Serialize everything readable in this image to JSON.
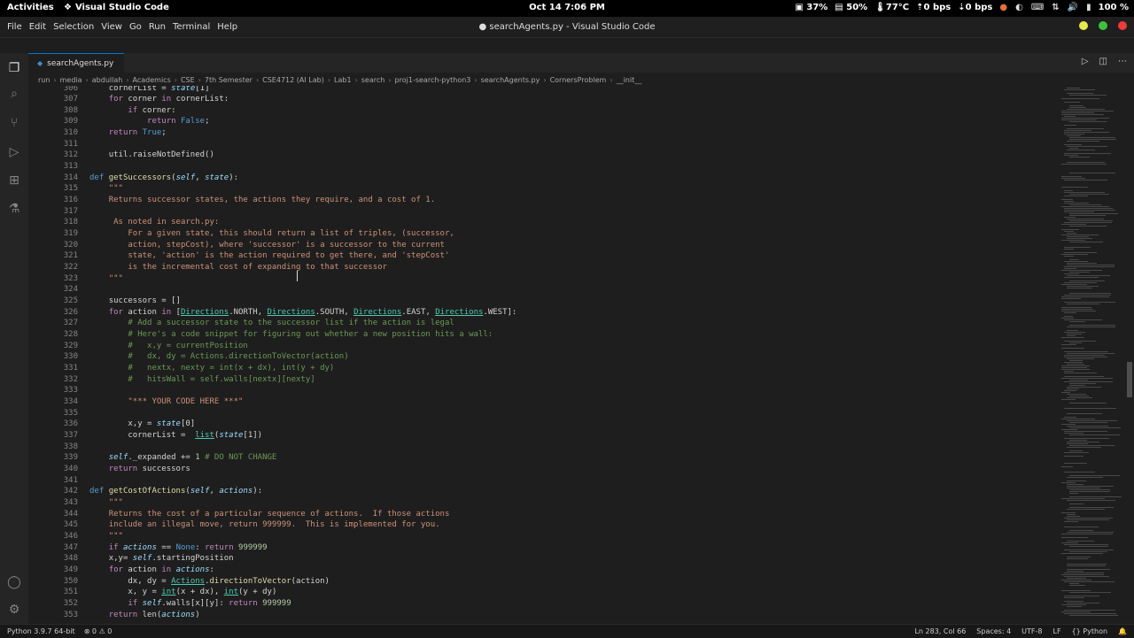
{
  "system_bar": {
    "activities": "Activities",
    "app_name": "Visual Studio Code",
    "clock": "Oct 14  7:06 PM",
    "cpu": "37%",
    "memory": "50%",
    "temp": "77°C",
    "net_up": "0 bps",
    "net_down": "0 bps",
    "battery": "100 %"
  },
  "window": {
    "title": "● searchAgents.py - Visual Studio Code",
    "menu": [
      "File",
      "Edit",
      "Selection",
      "View",
      "Go",
      "Run",
      "Terminal",
      "Help"
    ]
  },
  "tab": {
    "label": "searchAgents.py"
  },
  "breadcrumb": [
    "run",
    "media",
    "abdullah",
    "Academics",
    "CSE",
    "7th Semester",
    "CSE4712 (AI Lab)",
    "Lab1",
    "search",
    "proj1-search-python3",
    "searchAgents.py",
    "CornersProblem",
    "__init__"
  ],
  "code_lines": [
    {
      "n": "306",
      "indent": 4,
      "t": [
        [
          "",
          "cornerList = "
        ],
        [
          "p",
          "state"
        ],
        [
          "",
          "[1]"
        ]
      ]
    },
    {
      "n": "307",
      "indent": 4,
      "t": [
        [
          "k",
          "for"
        ],
        [
          "",
          " corner "
        ],
        [
          "k",
          "in"
        ],
        [
          "",
          " cornerList:"
        ]
      ]
    },
    {
      "n": "308",
      "indent": 8,
      "t": [
        [
          "k",
          "if"
        ],
        [
          "",
          " corner:"
        ]
      ]
    },
    {
      "n": "309",
      "indent": 12,
      "t": [
        [
          "k",
          "return"
        ],
        [
          "d",
          " False"
        ],
        [
          "",
          ";"
        ]
      ]
    },
    {
      "n": "310",
      "indent": 4,
      "t": [
        [
          "k",
          "return"
        ],
        [
          "d",
          " True"
        ],
        [
          "",
          ";"
        ]
      ]
    },
    {
      "n": "311",
      "indent": 0,
      "t": []
    },
    {
      "n": "312",
      "indent": 4,
      "t": [
        [
          "",
          "util.raiseNotDefined()"
        ]
      ]
    },
    {
      "n": "313",
      "indent": 0,
      "t": []
    },
    {
      "n": "314",
      "indent": 0,
      "t": [
        [
          "d",
          "def"
        ],
        [
          "",
          " "
        ],
        [
          "f",
          "getSuccessors"
        ],
        [
          "",
          "("
        ],
        [
          "p",
          "self"
        ],
        [
          "",
          ", "
        ],
        [
          "p",
          "state"
        ],
        [
          "",
          "):"
        ]
      ]
    },
    {
      "n": "315",
      "indent": 4,
      "t": [
        [
          "s",
          "\"\"\""
        ]
      ]
    },
    {
      "n": "316",
      "indent": 4,
      "t": [
        [
          "s",
          "Returns successor states, the actions they require, and a cost of 1."
        ]
      ]
    },
    {
      "n": "317",
      "indent": 0,
      "t": []
    },
    {
      "n": "318",
      "indent": 5,
      "t": [
        [
          "s",
          "As noted in search.py:"
        ]
      ]
    },
    {
      "n": "319",
      "indent": 8,
      "t": [
        [
          "s",
          "For a given state, this should return a list of triples, (successor,"
        ]
      ]
    },
    {
      "n": "320",
      "indent": 8,
      "t": [
        [
          "s",
          "action, stepCost), where 'successor' is a successor to the current"
        ]
      ]
    },
    {
      "n": "321",
      "indent": 8,
      "t": [
        [
          "s",
          "state, 'action' is the action required to get there, and 'stepCost'"
        ]
      ]
    },
    {
      "n": "322",
      "indent": 8,
      "t": [
        [
          "s",
          "is the incremental cost of expanding to that successor"
        ]
      ]
    },
    {
      "n": "323",
      "indent": 4,
      "t": [
        [
          "s",
          "\"\"\""
        ]
      ]
    },
    {
      "n": "324",
      "indent": 0,
      "t": []
    },
    {
      "n": "325",
      "indent": 4,
      "t": [
        [
          "",
          "successors = []"
        ]
      ]
    },
    {
      "n": "326",
      "indent": 4,
      "t": [
        [
          "k",
          "for"
        ],
        [
          "",
          " action "
        ],
        [
          "k",
          "in"
        ],
        [
          "",
          " ["
        ],
        [
          "cls",
          "Directions"
        ],
        [
          "",
          ".NORTH, "
        ],
        [
          "cls",
          "Directions"
        ],
        [
          "",
          ".SOUTH, "
        ],
        [
          "cls",
          "Directions"
        ],
        [
          "",
          ".EAST, "
        ],
        [
          "cls",
          "Directions"
        ],
        [
          "",
          ".WEST]:"
        ]
      ]
    },
    {
      "n": "327",
      "indent": 8,
      "t": [
        [
          "c",
          "# Add a successor state to the successor list if the action is legal"
        ]
      ]
    },
    {
      "n": "328",
      "indent": 8,
      "t": [
        [
          "c",
          "# Here's a code snippet for figuring out whether a new position hits a wall:"
        ]
      ]
    },
    {
      "n": "329",
      "indent": 8,
      "t": [
        [
          "c",
          "#   x,y = currentPosition"
        ]
      ]
    },
    {
      "n": "330",
      "indent": 8,
      "t": [
        [
          "c",
          "#   dx, dy = Actions.directionToVector(action)"
        ]
      ]
    },
    {
      "n": "331",
      "indent": 8,
      "t": [
        [
          "c",
          "#   nextx, nexty = int(x + dx), int(y + dy)"
        ]
      ]
    },
    {
      "n": "332",
      "indent": 8,
      "t": [
        [
          "c",
          "#   hitsWall = self.walls[nextx][nexty]"
        ]
      ]
    },
    {
      "n": "333",
      "indent": 0,
      "t": []
    },
    {
      "n": "334",
      "indent": 8,
      "t": [
        [
          "s",
          "\"*** YOUR CODE HERE ***\""
        ]
      ]
    },
    {
      "n": "335",
      "indent": 0,
      "t": []
    },
    {
      "n": "336",
      "indent": 8,
      "t": [
        [
          "",
          "x,y = "
        ],
        [
          "p",
          "state"
        ],
        [
          "",
          "[0]"
        ]
      ]
    },
    {
      "n": "337",
      "indent": 8,
      "t": [
        [
          "",
          "cornerList =  "
        ],
        [
          "bi",
          "list"
        ],
        [
          "",
          "("
        ],
        [
          "p",
          "state"
        ],
        [
          "",
          "[1])"
        ]
      ]
    },
    {
      "n": "338",
      "indent": 0,
      "t": []
    },
    {
      "n": "339",
      "indent": 4,
      "t": [
        [
          "p",
          "self"
        ],
        [
          "",
          "._expanded += "
        ],
        [
          "n",
          "1"
        ],
        [
          "c",
          " # DO NOT CHANGE"
        ]
      ]
    },
    {
      "n": "340",
      "indent": 4,
      "t": [
        [
          "k",
          "return"
        ],
        [
          "",
          " successors"
        ]
      ]
    },
    {
      "n": "341",
      "indent": 0,
      "t": []
    },
    {
      "n": "342",
      "indent": 0,
      "t": [
        [
          "d",
          "def"
        ],
        [
          "",
          " "
        ],
        [
          "f",
          "getCostOfActions"
        ],
        [
          "",
          "("
        ],
        [
          "p",
          "self"
        ],
        [
          "",
          ", "
        ],
        [
          "p",
          "actions"
        ],
        [
          "",
          "):"
        ]
      ]
    },
    {
      "n": "343",
      "indent": 4,
      "t": [
        [
          "s",
          "\"\"\""
        ]
      ]
    },
    {
      "n": "344",
      "indent": 4,
      "t": [
        [
          "s",
          "Returns the cost of a particular sequence of actions.  If those actions"
        ]
      ]
    },
    {
      "n": "345",
      "indent": 4,
      "t": [
        [
          "s",
          "include an illegal move, return 999999.  This is implemented for you."
        ]
      ]
    },
    {
      "n": "346",
      "indent": 4,
      "t": [
        [
          "s",
          "\"\"\""
        ]
      ]
    },
    {
      "n": "347",
      "indent": 4,
      "t": [
        [
          "k",
          "if"
        ],
        [
          "",
          " "
        ],
        [
          "p",
          "actions"
        ],
        [
          "",
          " == "
        ],
        [
          "d",
          "None"
        ],
        [
          "",
          ": "
        ],
        [
          "k",
          "return"
        ],
        [
          "",
          " "
        ],
        [
          "n",
          "999999"
        ]
      ]
    },
    {
      "n": "348",
      "indent": 4,
      "t": [
        [
          "",
          "x,y= "
        ],
        [
          "p",
          "self"
        ],
        [
          "",
          ".startingPosition"
        ]
      ]
    },
    {
      "n": "349",
      "indent": 4,
      "t": [
        [
          "k",
          "for"
        ],
        [
          "",
          " action "
        ],
        [
          "k",
          "in"
        ],
        [
          "",
          " "
        ],
        [
          "p",
          "actions"
        ],
        [
          "",
          ":"
        ]
      ]
    },
    {
      "n": "350",
      "indent": 8,
      "t": [
        [
          "",
          "dx, dy = "
        ],
        [
          "cls",
          "Actions"
        ],
        [
          "",
          "."
        ],
        [
          "f",
          "directionToVector"
        ],
        [
          "",
          "(action)"
        ]
      ]
    },
    {
      "n": "351",
      "indent": 8,
      "t": [
        [
          "",
          "x, y = "
        ],
        [
          "bi",
          "int"
        ],
        [
          "",
          "(x + dx), "
        ],
        [
          "bi",
          "int"
        ],
        [
          "",
          "(y + dy)"
        ]
      ]
    },
    {
      "n": "352",
      "indent": 8,
      "t": [
        [
          "k",
          "if"
        ],
        [
          "",
          " "
        ],
        [
          "p",
          "self"
        ],
        [
          "",
          ".walls[x][y]: "
        ],
        [
          "k",
          "return"
        ],
        [
          "",
          " "
        ],
        [
          "n",
          "999999"
        ]
      ]
    },
    {
      "n": "353",
      "indent": 4,
      "t": [
        [
          "k",
          "return"
        ],
        [
          "",
          " len("
        ],
        [
          "p",
          "actions"
        ],
        [
          "",
          ")"
        ]
      ]
    }
  ],
  "status": {
    "python": "Python 3.9.7 64-bit",
    "errors": "⊗ 0 ⚠ 0",
    "position": "Ln 283, Col 66",
    "spaces": "Spaces: 4",
    "encoding": "UTF-8",
    "eol": "LF",
    "language": "Python"
  },
  "colors": {
    "window_bg": "#1e1e1e",
    "accent": "#0078d4",
    "keyword": "#c586c0",
    "string": "#ce9178",
    "comment": "#6a9955"
  }
}
